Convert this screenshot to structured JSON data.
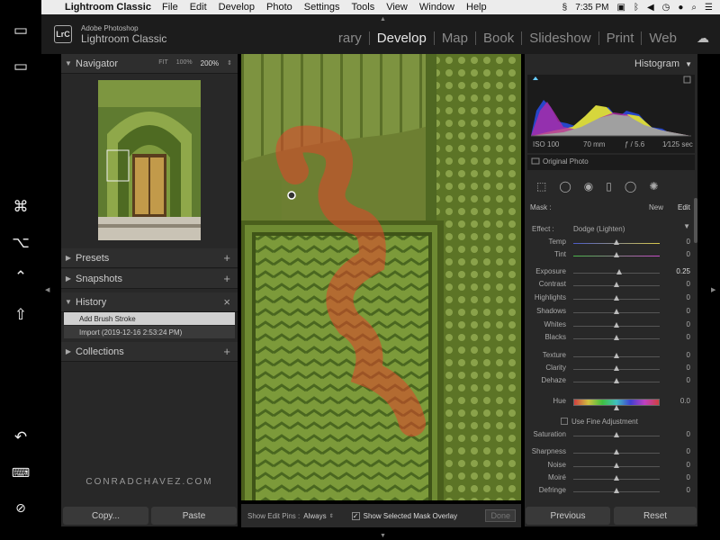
{
  "menubar": {
    "app_name": "Lightroom Classic",
    "items": [
      "File",
      "Edit",
      "Develop",
      "Photo",
      "Settings",
      "Tools",
      "View",
      "Window",
      "Help"
    ],
    "time": "7:35 PM"
  },
  "app": {
    "logo": "LrC",
    "name_line1": "Adobe Photoshop",
    "name_line2": "Lightroom Classic"
  },
  "modules": [
    "rary",
    "Develop",
    "Map",
    "Book",
    "Slideshow",
    "Print",
    "Web"
  ],
  "active_module": "Develop",
  "left_panel": {
    "navigator": {
      "title": "Navigator",
      "zoom_options": [
        "FIT",
        "100%",
        "200%"
      ],
      "zoom_selected": "200%"
    },
    "presets": {
      "title": "Presets"
    },
    "snapshots": {
      "title": "Snapshots"
    },
    "history": {
      "title": "History",
      "items": [
        "Add Brush Stroke",
        "Import (2019-12-16 2:53:24 PM)"
      ]
    },
    "collections": {
      "title": "Collections"
    },
    "copy_button": "Copy...",
    "paste_button": "Paste"
  },
  "watermark": "CONRADCHAVEZ.COM",
  "toolbar": {
    "edit_pins_label": "Show Edit Pins :",
    "edit_pins_value": "Always",
    "mask_overlay_label": "Show Selected Mask Overlay",
    "mask_overlay_checked": true,
    "done_button": "Done"
  },
  "right_panel": {
    "histogram": {
      "title": "Histogram",
      "iso": "ISO 100",
      "focal": "70 mm",
      "aperture": "ƒ / 5.6",
      "shutter": "1⁄125 sec",
      "original_photo": "Original Photo"
    },
    "mask": {
      "label": "Mask :",
      "new": "New",
      "edit": "Edit"
    },
    "effect": {
      "label": "Effect :",
      "value": "Dodge (Lighten)"
    },
    "sliders_group1": [
      {
        "label": "Temp",
        "value": "0"
      },
      {
        "label": "Tint",
        "value": "0"
      }
    ],
    "sliders_group2": [
      {
        "label": "Exposure",
        "value": "0.25"
      },
      {
        "label": "Contrast",
        "value": "0"
      },
      {
        "label": "Highlights",
        "value": "0"
      },
      {
        "label": "Shadows",
        "value": "0"
      },
      {
        "label": "Whites",
        "value": "0"
      },
      {
        "label": "Blacks",
        "value": "0"
      }
    ],
    "sliders_group3": [
      {
        "label": "Texture",
        "value": "0"
      },
      {
        "label": "Clarity",
        "value": "0"
      },
      {
        "label": "Dehaze",
        "value": "0"
      }
    ],
    "hue": {
      "label": "Hue",
      "value": "0.0"
    },
    "fine_adjustment": "Use Fine Adjustment",
    "saturation": {
      "label": "Saturation",
      "value": "0"
    },
    "sliders_group4": [
      {
        "label": "Sharpness",
        "value": "0"
      },
      {
        "label": "Noise",
        "value": "0"
      },
      {
        "label": "Moiré",
        "value": "0"
      },
      {
        "label": "Defringe",
        "value": "0"
      }
    ],
    "previous_button": "Previous",
    "reset_button": "Reset"
  },
  "colors": {
    "panel_bg": "#282828",
    "mask_overlay": "#e0452a",
    "photo_green": "#6d7f32"
  }
}
